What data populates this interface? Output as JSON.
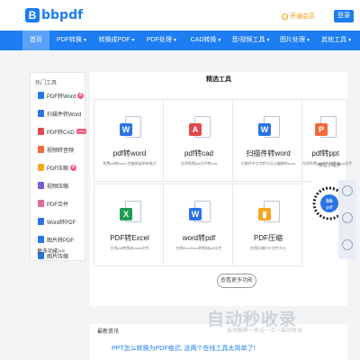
{
  "header": {
    "logo_badge": "B",
    "logo_text": "bbpdf",
    "vip_label": "开通会员",
    "login_label": "登录"
  },
  "nav": [
    {
      "label": "首页",
      "active": true
    },
    {
      "label": "PDF转换",
      "caret": "▼"
    },
    {
      "label": "转换成PDF",
      "caret": "▼"
    },
    {
      "label": "PDF处理",
      "caret": "▼"
    },
    {
      "label": "CAD转换",
      "caret": "▼"
    },
    {
      "label": "音/视频工具",
      "caret": "▼"
    },
    {
      "label": "图片处理",
      "caret": "▼"
    },
    {
      "label": "其他工具",
      "caret": "▼"
    }
  ],
  "sidebar": {
    "title": "热门工具",
    "items": [
      {
        "label": "PDF转Word",
        "badge": "hot",
        "color": "#2b73e6"
      },
      {
        "label": "扫描件转Word",
        "color": "#2b73e6"
      },
      {
        "label": "PDF转CAD",
        "badge": "new",
        "badge_text": "new",
        "color": "#e14a4a"
      },
      {
        "label": "视频转音频",
        "color": "#f06b3a"
      },
      {
        "label": "PDF压缩",
        "badge": "hot",
        "color": "#f5a623"
      },
      {
        "label": "视频压缩",
        "color": "#7c5cd6"
      },
      {
        "label": "PDF合并",
        "color": "#e06b9a"
      },
      {
        "label": "Word转PDF",
        "color": "#2b73e6"
      },
      {
        "label": "图片转PDF",
        "color": "#2b73e6"
      },
      {
        "label": "图片压缩",
        "color": "#2b73e6"
      }
    ],
    "more": "更多功能>>"
  },
  "main": {
    "title": "精选工具",
    "cards": [
      {
        "name": "pdf转word",
        "desc": "免费pdf转word,完美保留原有格式",
        "front_letter": "W",
        "front_color": "#2b73e6"
      },
      {
        "name": "pdf转cad",
        "desc": "在线免费pdf文件转cad",
        "front_letter": "A",
        "front_color": "#e14a4a"
      },
      {
        "name": "扫描件转word",
        "desc": "扫描件中文字转为可以编辑的word",
        "front_letter": "W",
        "front_color": "#2b73e6"
      },
      {
        "name": "pdf转ppt",
        "desc": "在线免费pdf文件转换成ppt文件",
        "front_letter": "P",
        "front_color": "#f06b3a"
      },
      {
        "name": "PDF转Excel",
        "desc": "在线pdf转换成excel文件",
        "front_letter": "X",
        "front_color": "#1f9d55"
      },
      {
        "name": "word转pdf",
        "desc": "在线Doc/Docx转换成pdf文件",
        "front_letter": "W",
        "front_color": "#2b73e6"
      },
      {
        "name": "PDF压缩",
        "desc": "在线压缩PDF文件大小",
        "front_letter": "▮",
        "front_color": "#f5a623"
      }
    ],
    "qr_label": "微信小程序",
    "qr_text": "bb pdf",
    "more_button": "查看更多功能"
  },
  "news": {
    "title": "最新资讯",
    "line": "PPT怎么转换为PDF格式, 这两个在线工具太简单了!"
  },
  "watermark": {
    "main": "自动秒收录",
    "sub": "自动推荐一来访一次一自动收录"
  }
}
